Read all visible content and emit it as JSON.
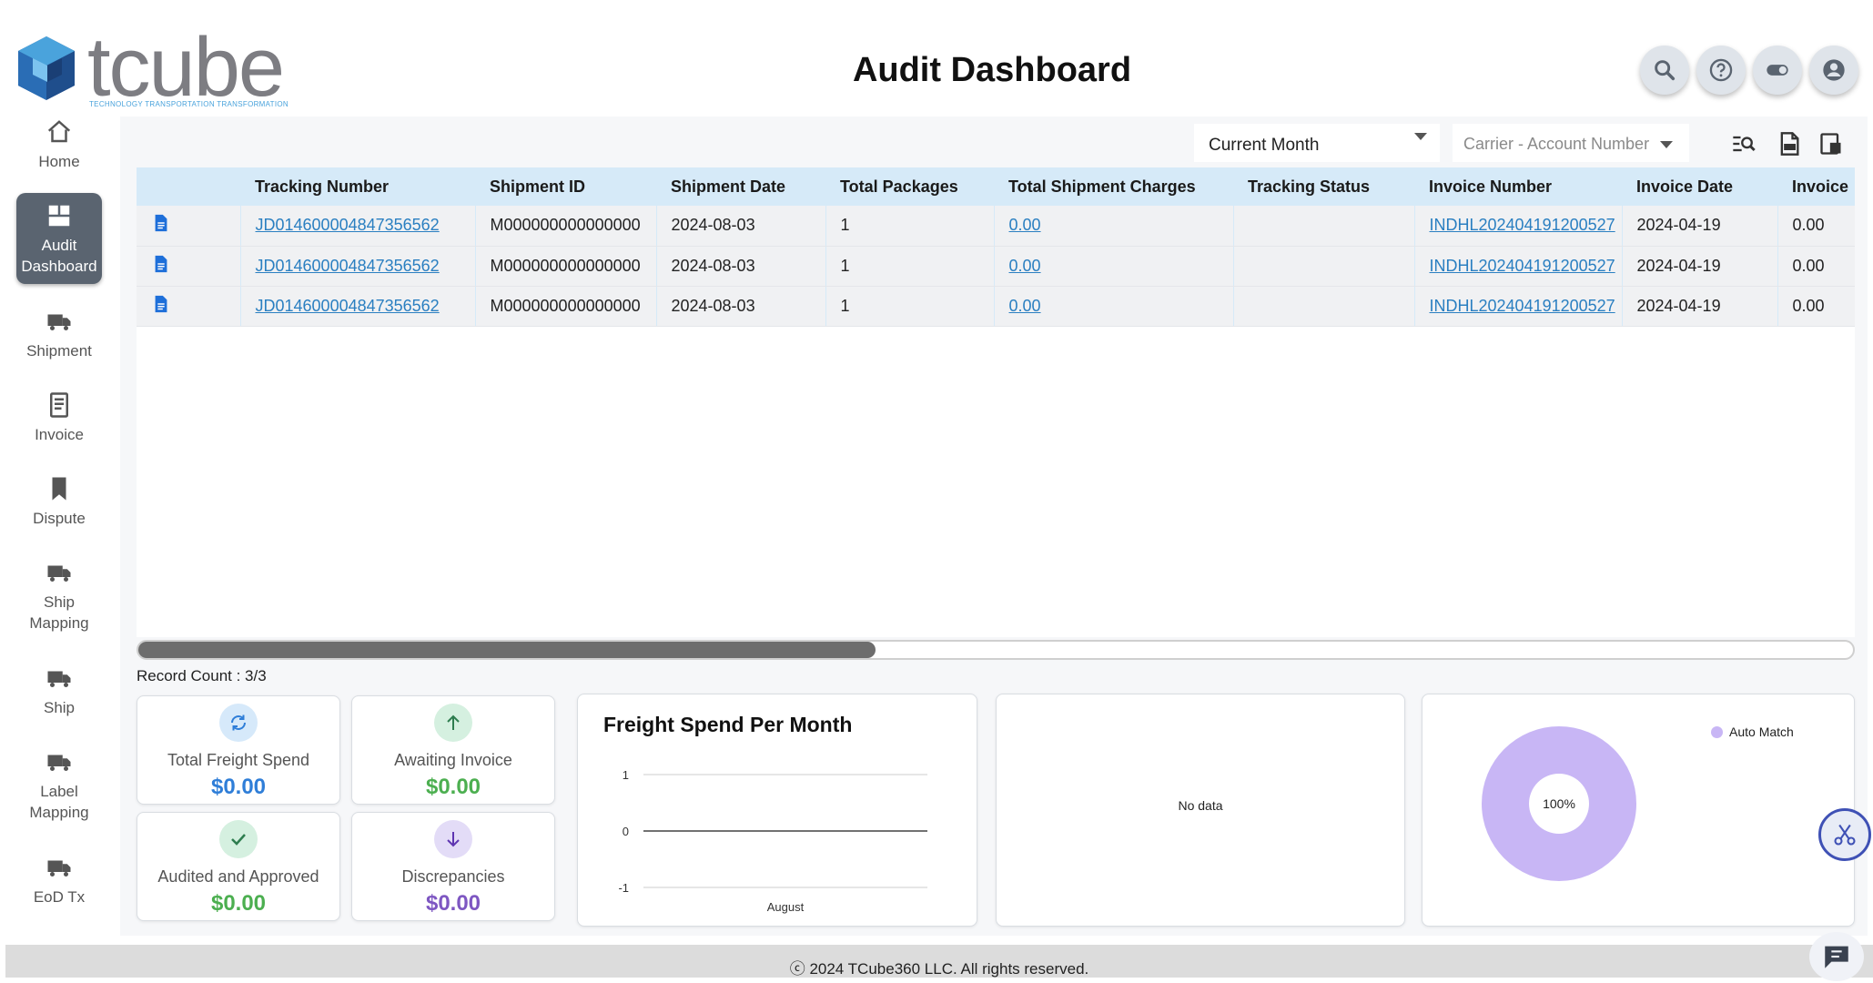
{
  "logo": {
    "wordmark": "tcube",
    "tagline": "TECHNOLOGY TRANSPORTATION TRANSFORMATION"
  },
  "header": {
    "title": "Audit Dashboard"
  },
  "header_icons": [
    "search-icon",
    "help-icon",
    "toggle-icon",
    "user-icon"
  ],
  "sidebar": {
    "items": [
      {
        "label": "Home",
        "icon": "home-icon"
      },
      {
        "label": "Audit Dashboard",
        "icon": "dashboard-icon",
        "active": true
      },
      {
        "label": "Shipment",
        "icon": "truck-icon"
      },
      {
        "label": "Invoice",
        "icon": "invoice-icon"
      },
      {
        "label": "Dispute",
        "icon": "bookmark-icon"
      },
      {
        "label": "Ship Mapping",
        "icon": "truck-icon"
      },
      {
        "label": "Ship",
        "icon": "truck-icon"
      },
      {
        "label": "Label Mapping",
        "icon": "truck-icon"
      },
      {
        "label": "EoD Tx",
        "icon": "truck-icon"
      }
    ]
  },
  "filters": {
    "period": "Current Month",
    "carrier_placeholder": "Carrier - Account Number"
  },
  "toolbar_icons": [
    "search-filter-icon",
    "export-pdf-icon",
    "column-settings-icon"
  ],
  "table": {
    "columns": [
      "",
      "Tracking Number",
      "Shipment ID",
      "Shipment Date",
      "Total Packages",
      "Total Shipment Charges",
      "Tracking Status",
      "Invoice Number",
      "Invoice Date",
      "Invoice"
    ],
    "rows": [
      {
        "tracking": "JD014600004847356562",
        "shipment_id": "M000000000000000",
        "shipment_date": "2024-08-03",
        "packages": "1",
        "charges": "0.00",
        "status": "",
        "invoice_number": "INDHL202404191200527",
        "invoice_date": "2024-04-19",
        "invoice": "0.00"
      },
      {
        "tracking": "JD014600004847356562",
        "shipment_id": "M000000000000000",
        "shipment_date": "2024-08-03",
        "packages": "1",
        "charges": "0.00",
        "status": "",
        "invoice_number": "INDHL202404191200527",
        "invoice_date": "2024-04-19",
        "invoice": "0.00"
      },
      {
        "tracking": "JD014600004847356562",
        "shipment_id": "M000000000000000",
        "shipment_date": "2024-08-03",
        "packages": "1",
        "charges": "0.00",
        "status": "",
        "invoice_number": "INDHL202404191200527",
        "invoice_date": "2024-04-19",
        "invoice": "0.00"
      }
    ],
    "scroll_fraction": 0.43
  },
  "record_count": "Record Count : 3/3",
  "stats": [
    {
      "label": "Total Freight Spend",
      "value": "$0.00",
      "icon": "refresh-icon",
      "color": "#2f7ed8",
      "icon_bg": "#d6e9fa"
    },
    {
      "label": "Awaiting Invoice",
      "value": "$0.00",
      "icon": "arrow-up-icon",
      "color": "#4caf50",
      "icon_bg": "#d5f0e0"
    },
    {
      "label": "Audited and Approved",
      "value": "$0.00",
      "icon": "check-icon",
      "color": "#4caf50",
      "icon_bg": "#d5f0e0"
    },
    {
      "label": "Discrepancies",
      "value": "$0.00",
      "icon": "arrow-down-icon",
      "color": "#7e57c2",
      "icon_bg": "#e3dcf7"
    }
  ],
  "freight_chart": {
    "title": "Freight Spend Per Month",
    "chart_data": {
      "type": "line",
      "title": "Freight Spend Per Month",
      "categories": [
        "August"
      ],
      "y_ticks": [
        "1",
        "0",
        "-1"
      ],
      "ylim": [
        -1,
        1
      ],
      "series": [
        {
          "values": [
            0
          ]
        }
      ]
    }
  },
  "middle_panel": {
    "message": "No data"
  },
  "donut_chart": {
    "chart_data": {
      "type": "pie",
      "categories": [
        "Auto Match"
      ],
      "values": [
        100
      ],
      "center_label": "100%"
    },
    "legend": "Auto Match",
    "color": "#c8b6f5"
  },
  "footer": {
    "text": "ⓒ 2024 TCube360 LLC. All rights reserved."
  }
}
